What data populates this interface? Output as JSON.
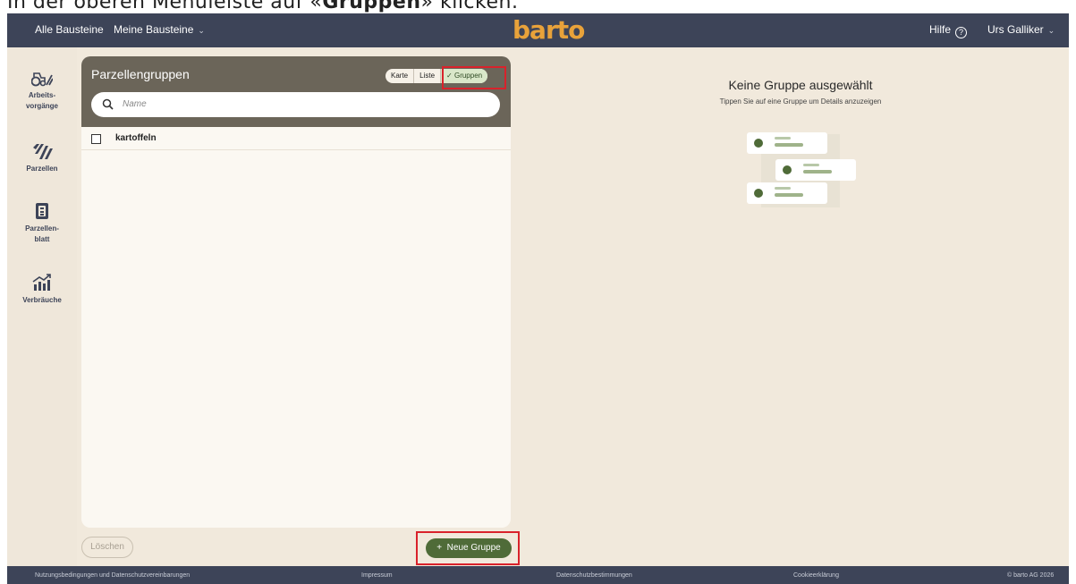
{
  "instruction": {
    "prefix": "In der oberen Menüleiste auf «",
    "bold": "Gruppen",
    "suffix": "» klicken."
  },
  "topbar": {
    "nav_all": "Alle Bausteine",
    "nav_mine": "Meine Bausteine",
    "brand": "barto",
    "help": "Hilfe",
    "user": "Urs Galliker",
    "brand_color": "#e8a23a",
    "bg_color": "#3d4458"
  },
  "sidebar": {
    "items": [
      {
        "label": "Arbeits-\nvorgänge",
        "icon": "tractor-icon"
      },
      {
        "label": "Parzellen",
        "icon": "field-icon"
      },
      {
        "label": "Parzellen-\nblatt",
        "icon": "document-icon"
      },
      {
        "label": "Verbräuche",
        "icon": "chart-icon"
      }
    ]
  },
  "panel": {
    "title": "Parzellengruppen",
    "view_toggle": [
      "Karte",
      "Liste",
      "Gruppen"
    ],
    "active_view": "Gruppen",
    "search_placeholder": "Name",
    "rows": [
      {
        "label": "kartoffeln"
      }
    ]
  },
  "actions": {
    "delete": "Löschen",
    "new_group": "Neue Gruppe"
  },
  "detail": {
    "title": "Keine Gruppe ausgewählt",
    "subtitle": "Tippen Sie auf eine Gruppe um Details anzuzeigen"
  },
  "footer": {
    "terms": "Nutzungsbedingungen und Datenschutzvereinbarungen",
    "imprint": "Impressum",
    "privacy": "Datenschutzbestimmungen",
    "cookies": "Cookieerklärung",
    "copyright": "© barto AG 2026"
  },
  "colors": {
    "highlight": "#d9222b",
    "accent_green": "#4f6b38",
    "panel_header": "#6b6559",
    "background": "#f1e9dc"
  }
}
